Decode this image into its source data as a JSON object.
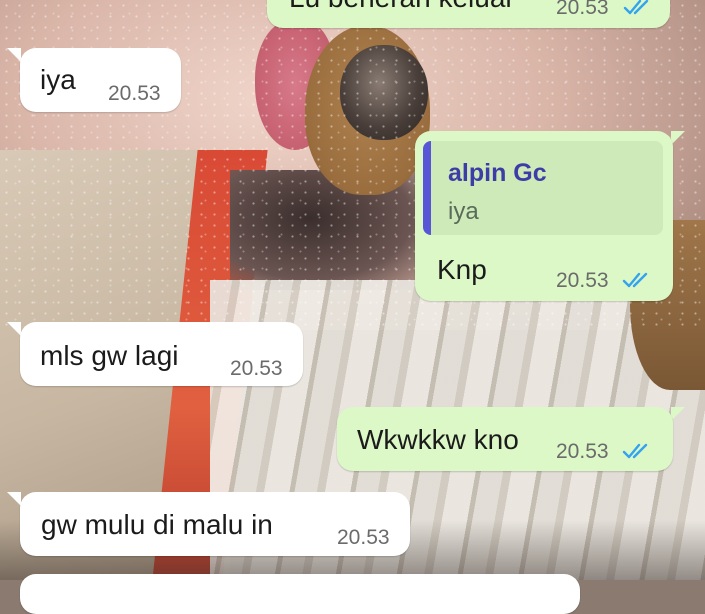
{
  "colors": {
    "incoming_bubble": "#ffffff",
    "outgoing_bubble": "#dcf8c6",
    "read_ticks": "#34a3ef",
    "quote_accent": "#5856d6"
  },
  "messages": [
    {
      "direction": "outgoing",
      "text": "Lu beneran keluar",
      "time": "20.53",
      "status": "read"
    },
    {
      "direction": "incoming",
      "text": "iya",
      "time": "20.53"
    },
    {
      "direction": "outgoing",
      "text": "Knp",
      "time": "20.53",
      "status": "read",
      "reply_to": {
        "sender": "alpin Gc",
        "text": "iya"
      }
    },
    {
      "direction": "incoming",
      "text": "mls gw lagi",
      "time": "20.53"
    },
    {
      "direction": "outgoing",
      "text": "Wkwkkw kno",
      "time": "20.53",
      "status": "read"
    },
    {
      "direction": "incoming",
      "text": "gw mulu di malu in",
      "time": "20.53"
    }
  ],
  "icons": {
    "read_status": "double-check-icon"
  }
}
